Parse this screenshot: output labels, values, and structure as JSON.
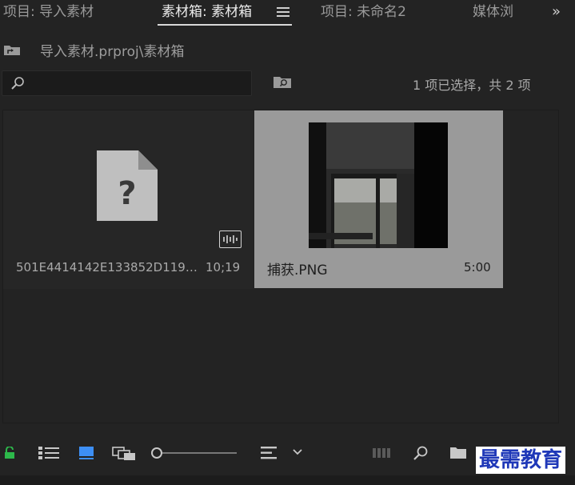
{
  "tabs": [
    {
      "label": "项目: 导入素材"
    },
    {
      "label": "素材箱: 素材箱"
    },
    {
      "label": "项目: 未命名2"
    },
    {
      "label": "媒体浏"
    }
  ],
  "overflow_icon": "»",
  "path": "导入素材.prproj\\素材箱",
  "search": {
    "placeholder": "",
    "value": ""
  },
  "selection_status": "1 项已选择，共 2 项",
  "items": [
    {
      "name": "501E4414142E133852D119…",
      "duration": "10;19",
      "icon": "missing-file-icon",
      "badge": "audio-badge",
      "selected": false
    },
    {
      "name": "捕获.PNG",
      "duration": "5:00",
      "icon": "image-thumbnail",
      "selected": true
    }
  ],
  "toolbar_icons": [
    "lock-icon",
    "list-view-icon",
    "icon-view-icon",
    "freeform-view-icon",
    "zoom-slider",
    "sort-icon",
    "chevron-down-icon",
    "automate-sequence-icon",
    "find-icon",
    "new-bin-icon",
    "new-item-icon",
    "delete-icon"
  ],
  "watermark": "最需教育",
  "colors": {
    "accent_blue": "#3d8ff5",
    "lock_green": "#2db84b",
    "selected_bg": "#9a9a9a"
  }
}
